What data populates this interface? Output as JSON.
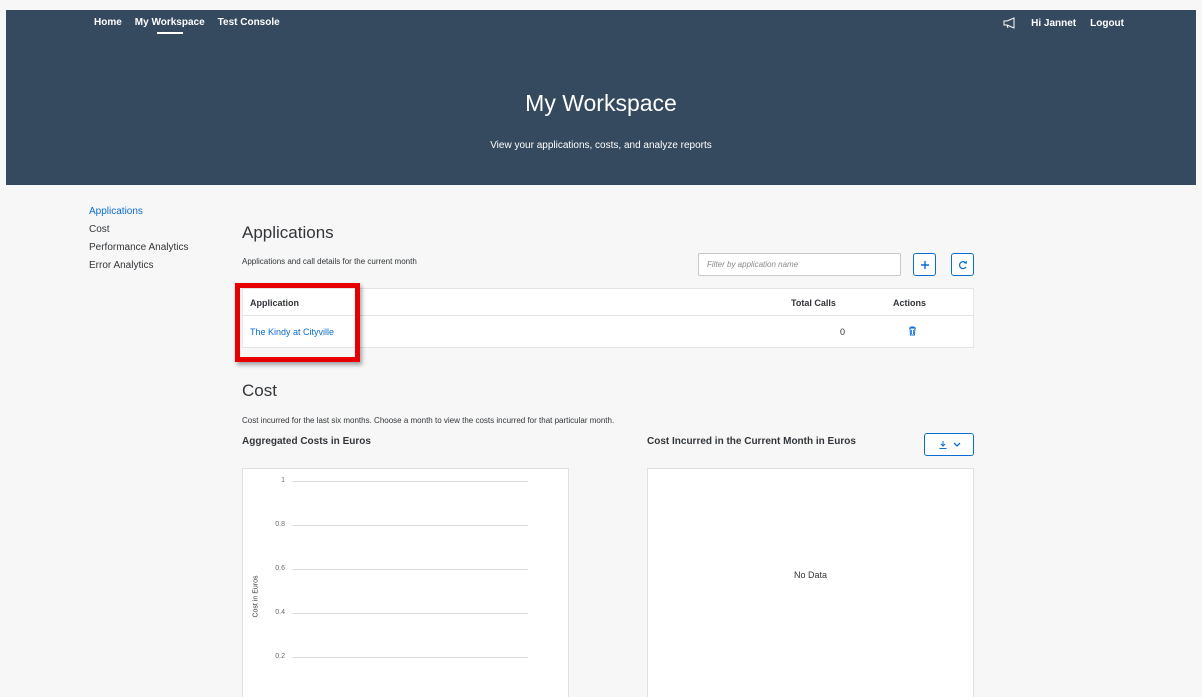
{
  "nav": {
    "home": "Home",
    "workspace": "My Workspace",
    "console": "Test Console",
    "greeting": "Hi Jannet",
    "logout": "Logout"
  },
  "hero": {
    "title": "My Workspace",
    "subtitle": "View your applications, costs, and analyze reports"
  },
  "sidebar": {
    "items": [
      {
        "label": "Applications"
      },
      {
        "label": "Cost"
      },
      {
        "label": "Performance Analytics"
      },
      {
        "label": "Error Analytics"
      }
    ]
  },
  "applications": {
    "title": "Applications",
    "description": "Applications and call details for the current month",
    "filter_placeholder": "Filter by application name",
    "columns": [
      "Application",
      "Total Calls",
      "Actions"
    ],
    "rows": [
      {
        "name": "The Kindy at Cityville",
        "calls": "0"
      }
    ]
  },
  "cost": {
    "title": "Cost",
    "description": "Cost incurred for the last six months. Choose a month to view the costs incurred for that particular month.",
    "aggregated_title": "Aggregated Costs in Euros",
    "current_title": "Cost Incurred in the Current Month in Euros",
    "no_data": "No Data"
  },
  "chart_data": {
    "type": "line",
    "title": "Aggregated Costs in Euros",
    "xlabel": "",
    "ylabel": "Cost in Euros",
    "yticks": [
      "1",
      "0.8",
      "0.6",
      "0.4",
      "0.2"
    ],
    "ylim": [
      0,
      1
    ],
    "grid": true,
    "series": []
  },
  "colors": {
    "header": "#354a5f",
    "accent": "#0a6ed1",
    "highlight": "#e60000"
  }
}
